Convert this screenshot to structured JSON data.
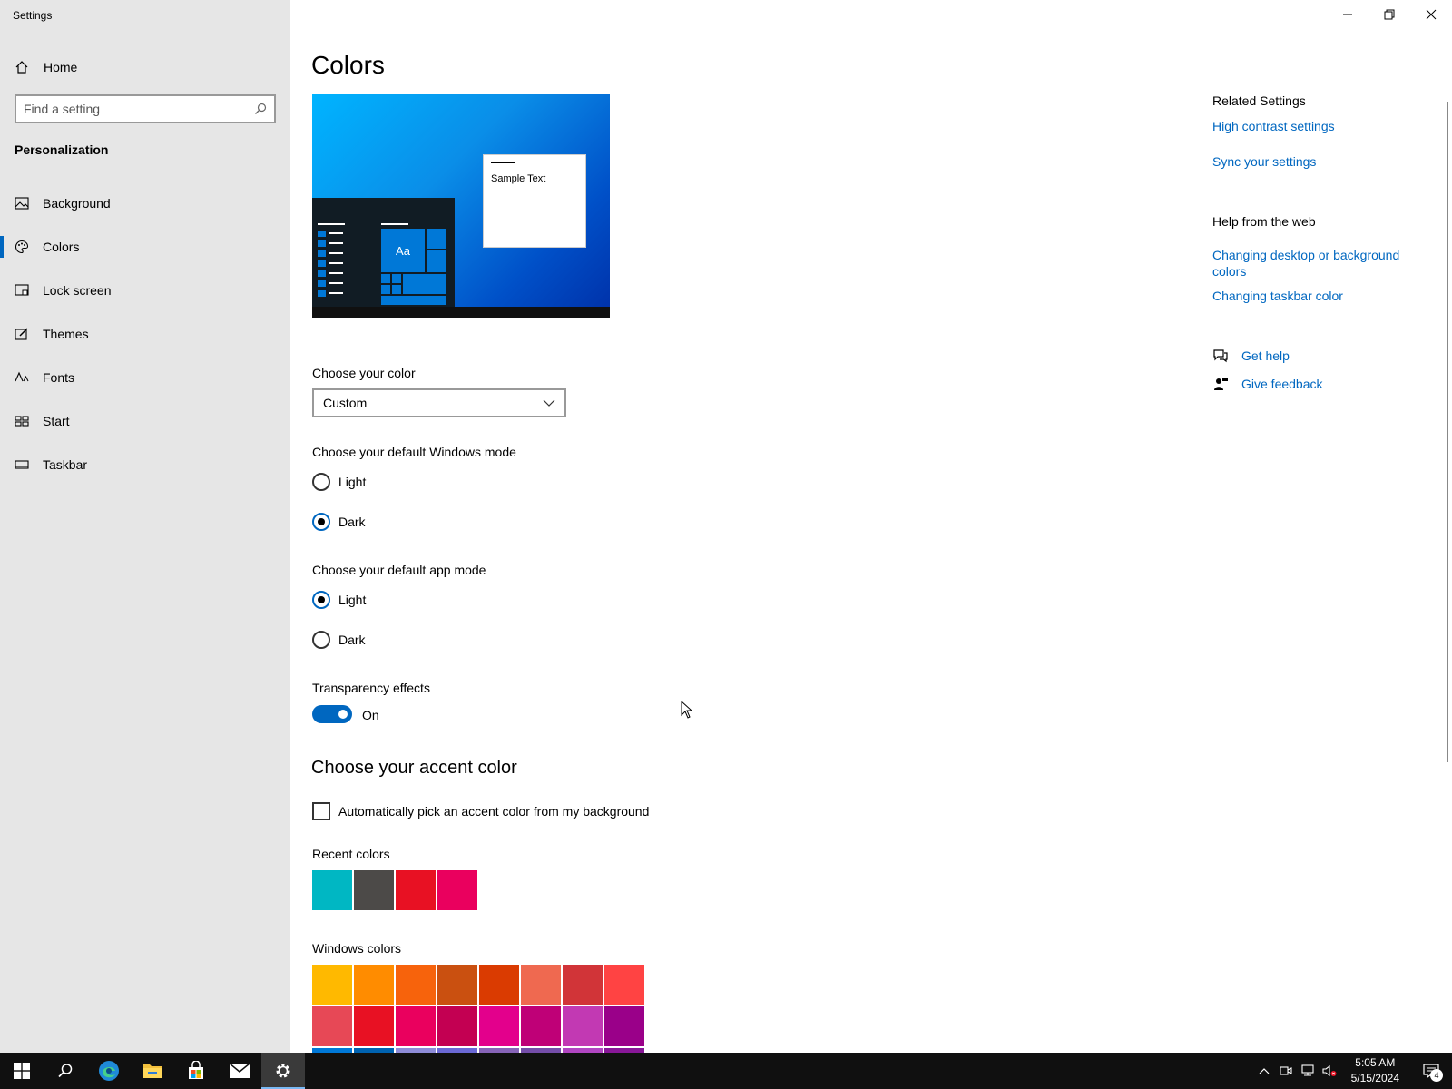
{
  "window": {
    "title": "Settings"
  },
  "sidebar": {
    "home_label": "Home",
    "search_placeholder": "Find a setting",
    "section_title": "Personalization",
    "items": [
      {
        "label": "Background",
        "icon": "image-icon"
      },
      {
        "label": "Colors",
        "icon": "palette-icon",
        "active": true
      },
      {
        "label": "Lock screen",
        "icon": "lock-screen-icon"
      },
      {
        "label": "Themes",
        "icon": "brush-icon"
      },
      {
        "label": "Fonts",
        "icon": "font-icon"
      },
      {
        "label": "Start",
        "icon": "start-icon"
      },
      {
        "label": "Taskbar",
        "icon": "taskbar-icon"
      }
    ]
  },
  "main": {
    "title": "Colors",
    "preview_text": "Sample Text",
    "preview_tile_text": "Aa",
    "choose_color_label": "Choose your color",
    "choose_color_value": "Custom",
    "windows_mode_label": "Choose your default Windows mode",
    "windows_mode_options": [
      "Light",
      "Dark"
    ],
    "windows_mode_selected": "Dark",
    "app_mode_label": "Choose your default app mode",
    "app_mode_options": [
      "Light",
      "Dark"
    ],
    "app_mode_selected": "Light",
    "transparency_label": "Transparency effects",
    "transparency_state": "On",
    "accent_title": "Choose your accent color",
    "auto_accent_label": "Automatically pick an accent color from my background",
    "recent_colors_label": "Recent colors",
    "recent_colors": [
      "#00b7c3",
      "#4c4a48",
      "#e81123",
      "#ea005e"
    ],
    "windows_colors_label": "Windows colors",
    "windows_colors_row1": [
      "#ffb900",
      "#ff8c00",
      "#f7630c",
      "#ca5010",
      "#da3b01",
      "#ef6950",
      "#d13438",
      "#ff4343"
    ],
    "windows_colors_row2": [
      "#e74856",
      "#e81123",
      "#ea005e",
      "#c30052",
      "#e3008c",
      "#bf0077",
      "#c239b3",
      "#9a0089"
    ],
    "windows_colors_row3": [
      "#0078d7",
      "#0063b1",
      "#8e8cd8",
      "#6b69d6",
      "#8764b8",
      "#744da9",
      "#b146c2",
      "#881798"
    ]
  },
  "right": {
    "related_title": "Related Settings",
    "related_links": [
      "High contrast settings",
      "Sync your settings"
    ],
    "help_title": "Help from the web",
    "help_links": [
      "Changing desktop or background colors",
      "Changing taskbar color"
    ],
    "get_help": "Get help",
    "give_feedback": "Give feedback"
  },
  "taskbar": {
    "time": "5:05 AM",
    "date": "5/15/2024",
    "notification_count": "4"
  },
  "colors": {
    "accent": "#0067c0",
    "sidebar_bg": "#e6e6e6",
    "taskbar_bg": "#101010"
  }
}
